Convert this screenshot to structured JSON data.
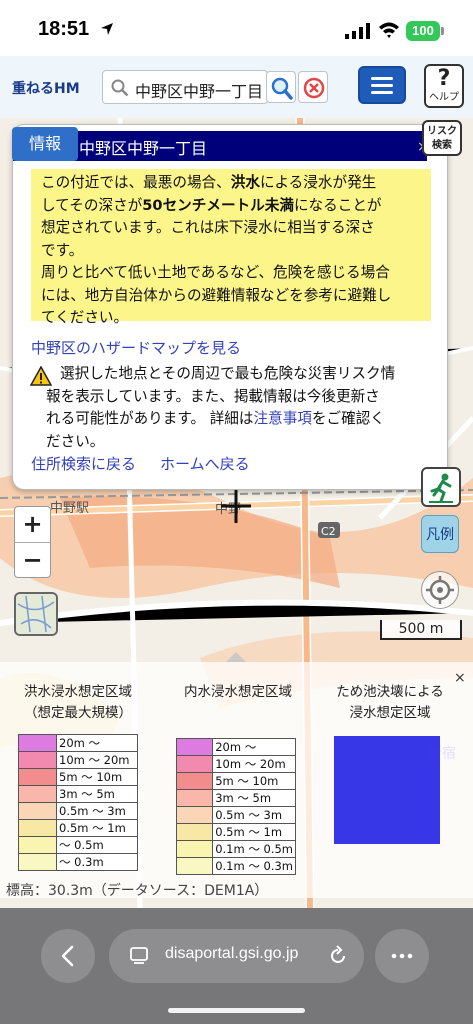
{
  "status": {
    "time": "18:51",
    "battery": "100"
  },
  "toolbar": {
    "brand": "重ねるHM",
    "search_value": "中野区中野一丁目",
    "help_label": "ヘルプ",
    "help_symbol": "?",
    "icons": [
      "search-icon",
      "clear-icon",
      "menu-icon",
      "help-icon"
    ]
  },
  "info": {
    "tab_label": "情報",
    "title": "中野区中野一丁目",
    "close": "×",
    "risk_button": [
      "リスク",
      "検索"
    ],
    "warning": {
      "p1_a": "この付近では、最悪の場合、",
      "p1_b": "洪水",
      "p1_c": "による浸水が発生",
      "p2_a": "してその深さが",
      "p2_b": "50センチメートル未満",
      "p2_c": "になることが",
      "p3": "想定されています。これは床下浸水に相当する深さ",
      "p4": "です。",
      "p5": "周りと比べて低い土地であるなど、危険を感じる場合",
      "p6": "には、地方自治体からの避難情報などを参考に避難し",
      "p7": "てください。"
    },
    "hazard_link": "中野区のハザードマップを見る",
    "note_1": "選択した地点とその周辺で最も危険な災害リスク情",
    "note_2": "報を表示しています。また、掲載情報は今後更新さ",
    "note_3_a": "れる可能性があります。 詳細は",
    "note_3_link": "注意事項",
    "note_3_b": "をご確認く",
    "note_4": "ださい。",
    "back_search": "住所検索に戻る",
    "back_home": "ホームへ戻る"
  },
  "map": {
    "zoom_in": "+",
    "zoom_out": "−",
    "legend_button": "凡例",
    "scale": "500 m",
    "labels": {
      "station": "中野駅",
      "place": "中野",
      "road": "C2",
      "shinjuku": "新宿"
    }
  },
  "legend": {
    "close": "×",
    "flood_title_1": "洪水浸水想定区域",
    "flood_title_2": "（想定最大規模）",
    "inland_title": "内水浸水想定区域",
    "pond_title_1": "ため池決壊による",
    "pond_title_2": "浸水想定区域",
    "flood_rows": [
      {
        "label": "20m 〜",
        "color": "#dd7be0"
      },
      {
        "label": "10m 〜 20m",
        "color": "#f28ab0"
      },
      {
        "label": "5m 〜 10m",
        "color": "#f38c8c"
      },
      {
        "label": "3m 〜 5m",
        "color": "#f9b7ac"
      },
      {
        "label": "0.5m 〜 3m",
        "color": "#fbd6b6"
      },
      {
        "label": "0.5m 〜 1m",
        "color": "#f8e8a6"
      },
      {
        "label": "〜 0.5m",
        "color": "#f9f5b0"
      },
      {
        "label": "〜 0.3m",
        "color": "#f9f7c2"
      }
    ],
    "inland_rows": [
      {
        "label": "20m 〜",
        "color": "#dd7be0"
      },
      {
        "label": "10m 〜 20m",
        "color": "#f28ab0"
      },
      {
        "label": "5m 〜 10m",
        "color": "#f38c8c"
      },
      {
        "label": "3m 〜 5m",
        "color": "#f9b7ac"
      },
      {
        "label": "0.5m 〜 3m",
        "color": "#fbd6b6"
      },
      {
        "label": "0.5m 〜 1m",
        "color": "#f8e8a6"
      },
      {
        "label": "0.1m 〜 0.5m",
        "color": "#f9f5b0"
      },
      {
        "label": "0.1m 〜 0.3m",
        "color": "#f9f7c2"
      }
    ],
    "pond_color": "#2a2ae6"
  },
  "elevation": "標高：30.3m（データソース：DEM1A）",
  "browser": {
    "url": "disaportal.gsi.go.jp"
  }
}
